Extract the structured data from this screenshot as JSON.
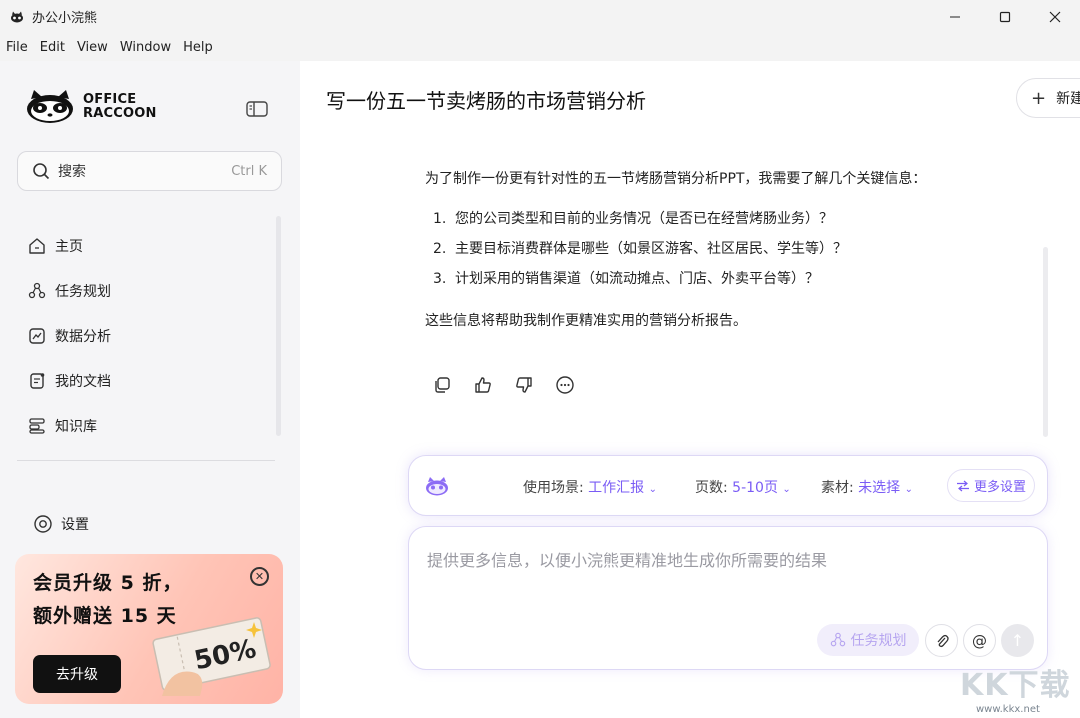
{
  "window": {
    "title": "办公小浣熊",
    "controls": [
      "minimize",
      "maximize",
      "close"
    ]
  },
  "menu": [
    "File",
    "Edit",
    "View",
    "Window",
    "Help"
  ],
  "sidebar": {
    "logo": {
      "line1": "OFFICE",
      "line2": "RACCOON"
    },
    "search": {
      "label": "搜索",
      "shortcut": "Ctrl K"
    },
    "nav": [
      {
        "label": "主页",
        "icon": "home-icon"
      },
      {
        "label": "任务规划",
        "icon": "task-plan-icon"
      },
      {
        "label": "数据分析",
        "icon": "chart-icon"
      },
      {
        "label": "我的文档",
        "icon": "document-icon"
      },
      {
        "label": "知识库",
        "icon": "knowledge-base-icon"
      }
    ],
    "settings_label": "设置",
    "promo": {
      "line1": "会员升级 5 折，",
      "line2": "额外赠送 15 天",
      "button": "去升级",
      "ticket_text": "50%"
    }
  },
  "main": {
    "title": "写一份五一节卖烤肠的市场营销分析",
    "new_button": "新建",
    "message": {
      "intro": "为了制作一份更有针对性的五一节烤肠营销分析PPT，我需要了解几个关键信息：",
      "items": [
        "您的公司类型和目前的业务情况（是否已在经营烤肠业务）？",
        "主要目标消费群体是哪些（如景区游客、社区居民、学生等）？",
        "计划采用的销售渠道（如流动摊点、门店、外卖平台等）？"
      ],
      "outro": "这些信息将帮助我制作更精准实用的营销分析报告。"
    },
    "options": {
      "scene_label": "使用场景:",
      "scene_value": "工作汇报",
      "pages_label": "页数:",
      "pages_value": "5-10页",
      "material_label": "素材:",
      "material_value": "未选择",
      "more_settings": "更多设置"
    },
    "input": {
      "placeholder": "提供更多信息，以便小浣熊更精准地生成你所需要的结果",
      "plan_chip": "任务规划"
    }
  },
  "watermark": {
    "big": "KK下载",
    "small": "www.kkx.net"
  },
  "colors": {
    "accent": "#7a5cf5",
    "sidebar_bg": "#f5f5f7",
    "promo": "#ffc4b6"
  }
}
